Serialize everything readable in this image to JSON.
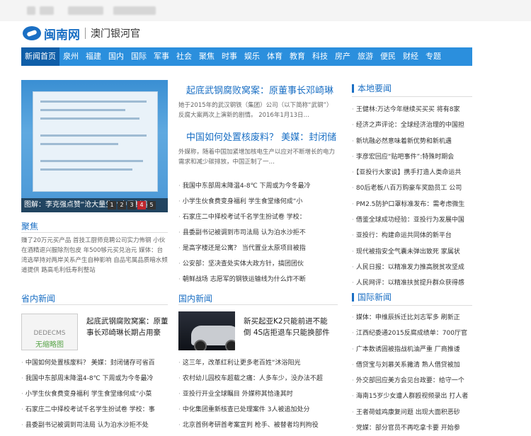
{
  "header": {
    "logo_text": "闽南网",
    "site_name": "澳门银河官"
  },
  "nav": [
    "新闻首页",
    "泉州",
    "福建",
    "国内",
    "国际",
    "军事",
    "社会",
    "聚焦",
    "时事",
    "娱乐",
    "体育",
    "教育",
    "科技",
    "房产",
    "旅游",
    "便民",
    "财经",
    "专题"
  ],
  "slider": {
    "caption": "图解：李克强点赞“沧大量生”“中国制造",
    "pages": [
      "1",
      "2",
      "3",
      "4",
      "5"
    ],
    "active_page": "4"
  },
  "headlines": [
    {
      "title": "起底武钢腐败窝案：原董事长邓崎琳",
      "summary": "她于2015年的武汉钢铁（集团）公司（以下简称“武钢”）反腐大案两次上演新的剧情。 2016年1月13日…"
    },
    {
      "title": "中国如何处置核废料？ 美媒：封闭储",
      "summary": "外媒称，随着中国加紧增加核电生产以应对不断增长的电力需求和减少碳排放，中国正制了一…"
    }
  ],
  "center_list": [
    "我国中东部周末降温4-8℃ 下周或为今冬最冷",
    "小学生伙食费变身福利 学生食堂缘何成“小",
    "石家庄二中择校考试千名学生扮试卷 学校：",
    "县委副书记被调到市司法局 认为泊水沙拒不",
    "是高字楼还是公寓？ 当代置业太原项目被指",
    "公安部：坚决查处实体大政方针，搞团团伙",
    "朝鲜战场 志愿军的钢铁运输线为什么炸不断"
  ],
  "jujiao": {
    "title": "聚焦",
    "text": "赚了20万元买产品 首技工厨师竞聘公司实力佈钢 小伙在酒精退兴服除剂包皮 年500够元买兑治元 媒体：台湾选举持对两岸关系产生自种影响 自品宅属品质暗水频道提供 路高毛利低寿利整站"
  },
  "bendi": {
    "title": "本地要闻",
    "items": [
      "王健林:万达今年继续买买买 将有8家",
      "经济之声评论：全球经济治理的中国担",
      "新坑融必然意味着新优势和新机遇",
      "李彦宏回应“贴吧事件”:特殊时期会",
      "【亚投行大家谈】携手打造人类命运共",
      "80后老板八百万购豪车奖励员工 公司",
      "PM2.5防护口罩标准发布：需考虑微生",
      "借鉴全球成功经验：亚投行为发展中国",
      "亚投行：构建命运共同体的新平台",
      "现代被指安全气囊未弹出致死 家属状",
      "人民日报：以精准发力推高脱贫攻坚成",
      "人民网评：以精准扶贫提升群众获得感"
    ]
  },
  "shengnei": {
    "title": "省内新闻",
    "thumb_line1": "DEDECMS",
    "thumb_line2": "无缩略图",
    "feature": "起底武钢腐败窝案：原董事长邓崎琳长期占用豪",
    "items": [
      "中国如何处置核废料？ 美媒：封闭储存可省百",
      "我国中东部周末降温4-8℃ 下周或为今冬最冷",
      "小学生伙食费变身福利 学生食堂缘何成“小菜",
      "石家庄二中择校考试千名学生扮试卷 学校：事",
      "县委副书记被调到司法局 认为泊水沙拒不处"
    ]
  },
  "guonei": {
    "title": "国内新闻",
    "feature": "新买起亚K2只能前进不能倒 4S店拒退车只能换部件",
    "items": [
      "这三年，改革红利让更多老百姓“沐浴阳光",
      "农村幼儿园校车超载之痛：人多车少，没办法不超",
      "亚投行开业全球瞩目 外媒称其恰逢其时",
      "中化集团重新核查已处理案件 3人被追加处分",
      "北京首例考研首考案宣判 枪手、被替者均判拘役"
    ]
  },
  "guoji": {
    "title": "国际新闻",
    "items": [
      "媒体：申维辰拆迁比刘志军多 刷新正",
      "江西纪委通2015反腐成绩单：700厅官",
      "广本数诱固被指战机油严重 厂商推诿",
      "借贷宝与刘慕关系撇清 熟人借贷被加",
      "外交部回应美方会见台政要：给守一个",
      "海南15岁少女遭人群殴视频录出 打人者",
      "王者荷蛙鸡康复问题 出现大面积恶砂",
      "党媒：部分官员不再吃拿卡要 开始参"
    ]
  }
}
